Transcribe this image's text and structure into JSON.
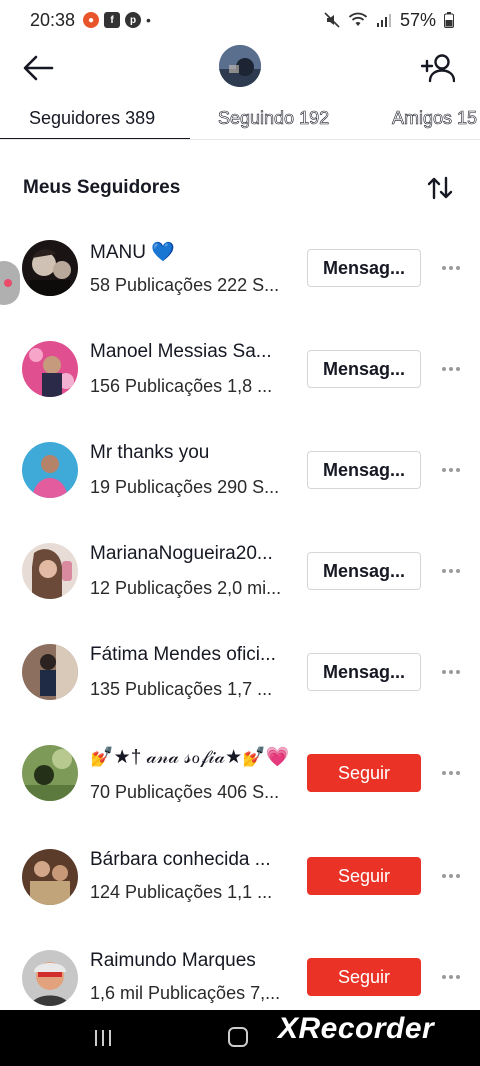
{
  "status_bar": {
    "time": "20:38",
    "battery": "57%",
    "notification_icons": [
      "screen-recorder-icon",
      "facebook-icon",
      "pinterest-icon",
      "dot-icon"
    ],
    "system_icons": [
      "mute-icon",
      "wifi-icon",
      "signal-icon",
      "battery-icon"
    ]
  },
  "tabs": [
    {
      "label": "Seguidores 389",
      "active": true
    },
    {
      "label": "Seguindo 192",
      "active": false
    },
    {
      "label": "Amigos 15",
      "active": false
    }
  ],
  "section": {
    "title": "Meus Seguidores"
  },
  "followers": [
    {
      "name": "MANU 💙",
      "stats": "58 Publicações 222 S...",
      "button": "Mensag...",
      "button_type": "message"
    },
    {
      "name": "Manoel Messias Sa...",
      "stats": "156 Publicações 1,8 ...",
      "button": "Mensag...",
      "button_type": "message"
    },
    {
      "name": "Mr thanks you",
      "stats": "19 Publicações 290 S...",
      "button": "Mensag...",
      "button_type": "message"
    },
    {
      "name": "MarianaNogueira20...",
      "stats": "12 Publicações 2,0 mi...",
      "button": "Mensag...",
      "button_type": "message"
    },
    {
      "name": "Fátima Mendes ofici...",
      "stats": "135 Publicações 1,7 ...",
      "button": "Mensag...",
      "button_type": "message"
    },
    {
      "name": "💅★† 𝒶𝓃𝒶 𝓈ℴ𝒻𝒾𝒶★💅💗",
      "stats": "70 Publicações 406 S...",
      "button": "Seguir",
      "button_type": "follow"
    },
    {
      "name": "Bárbara conhecida ...",
      "stats": "124 Publicações 1,1 ...",
      "button": "Seguir",
      "button_type": "follow"
    },
    {
      "name": "Raimundo Marques",
      "stats": "1,6 mil Publicações 7,...",
      "button": "Seguir",
      "button_type": "follow"
    }
  ],
  "watermark": "XRecorder",
  "colors": {
    "follow": "#ea3326",
    "text": "#161823"
  }
}
